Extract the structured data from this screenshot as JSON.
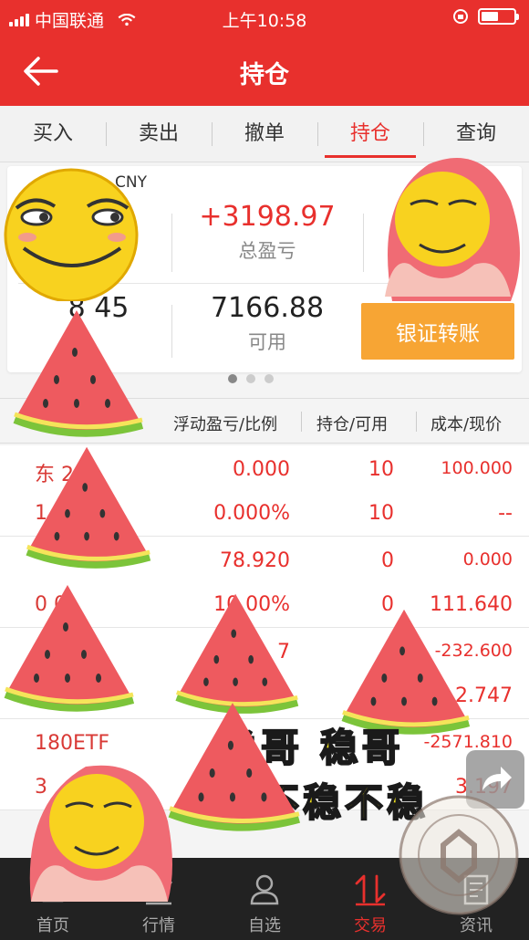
{
  "status_bar": {
    "carrier": "中国联通",
    "time": "上午10:58"
  },
  "nav": {
    "title": "持仓"
  },
  "tabs": [
    "买入",
    "卖出",
    "撤单",
    "持仓",
    "查询"
  ],
  "active_tab": 3,
  "account": {
    "currency": "CNY",
    "total_pnl": "+3198.97",
    "total_pnl_label": "总盈亏",
    "asset_partial": "8 45",
    "available": "7166.88",
    "available_label": "可用",
    "bank_transfer_button": "银证转账"
  },
  "table": {
    "headers": [
      "浮动盈亏/比例",
      "持仓/可用",
      "成本/现价"
    ]
  },
  "rows": [
    {
      "name": "东 2",
      "code": "1",
      "pnl": "0.000",
      "ratio": "0.000%",
      "hold": "10",
      "avail": "10",
      "cost": "100.000",
      "price": "--"
    },
    {
      "name": "",
      "code": "0 0",
      "pnl": "78.920",
      "ratio": "10 00%",
      "hold": "0",
      "avail": "0",
      "cost": "0.000",
      "price": "111.640"
    },
    {
      "name": "",
      "code": "",
      "pnl": "7",
      "ratio": "",
      "hold": "",
      "avail": "",
      "cost": "-232.600",
      "price": "2.747"
    },
    {
      "name": "180ETF",
      "code": "3",
      "pnl": "",
      "ratio": "",
      "hold": "",
      "avail": "",
      "cost": "-2571.810",
      "price": "3.197"
    }
  ],
  "bottom_nav": [
    "首页",
    "行情",
    "自选",
    "交易",
    "资讯"
  ],
  "bottom_active": 3,
  "sticker_text": {
    "line1": "稳哥 稳哥",
    "line2": "稳不稳不稳"
  },
  "colors": {
    "brand_red": "#e8302d",
    "orange": "#f7a534",
    "dark_bar": "#222222"
  },
  "icons": [
    "back-arrow-icon",
    "wifi-icon",
    "battery-icon",
    "home-icon",
    "chart-icon",
    "person-icon",
    "trade-arrows-icon",
    "news-icon",
    "share-icon"
  ]
}
